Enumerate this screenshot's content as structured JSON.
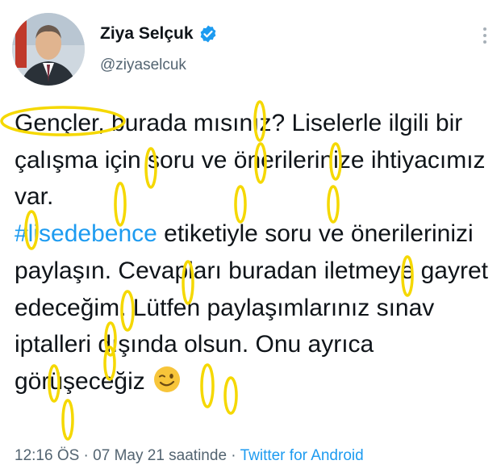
{
  "author": {
    "display_name": "Ziya Selçuk",
    "handle": "@ziyaselcuk",
    "verified": true
  },
  "tweet": {
    "text_before_hashtag": "Gençler, burada mısınız? Liselerle ilgili bir çalışma için soru ve önerilerinize ihtiyacımız var.\n",
    "hashtag": "#lisedebence",
    "text_after_hashtag": " etiketiyle soru ve önerilerinizi paylaşın. Cevapları buradan iletmeye gayret edeceğim. Lütfen paylaşımlarınız sınav iptalleri dışında olsun. Onu ayrıca görüşeceğiz",
    "emoji": "winking-face-icon"
  },
  "meta": {
    "time": "12:16 ÖS",
    "separator": " · ",
    "date_label": "07 May 21 saatinde",
    "source": "Twitter for Android"
  },
  "colors": {
    "link": "#1d9bf0",
    "secondary_text": "#536471",
    "annotation_yellow": "#f5d800"
  }
}
